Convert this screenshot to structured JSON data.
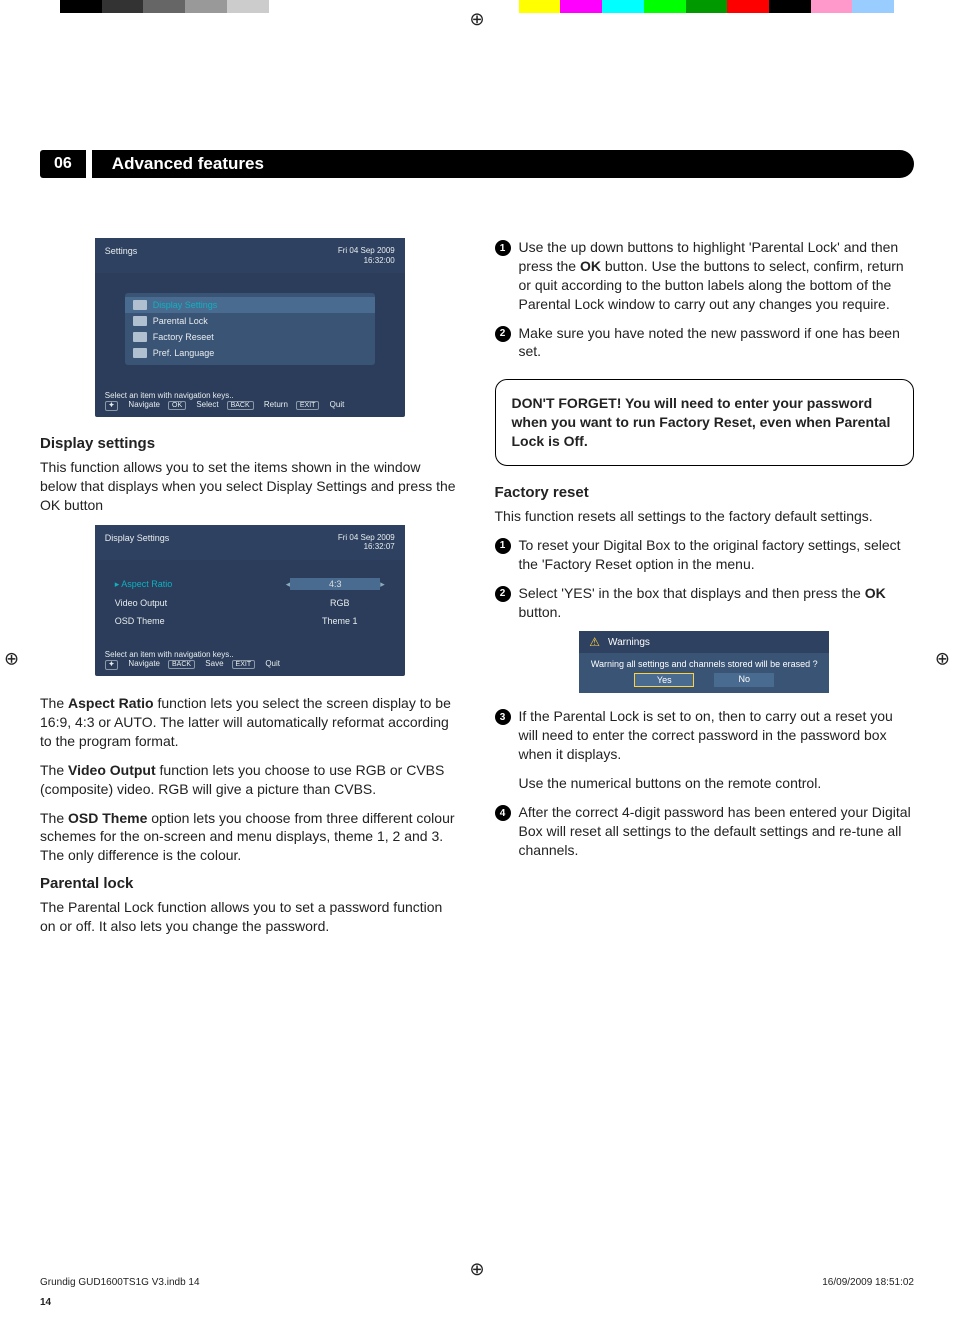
{
  "cal_colors": [
    "#000",
    "#333",
    "#666",
    "#999",
    "#ccc",
    "#fff",
    "#fff",
    "#fff",
    "#fff",
    "#fff",
    "#fff",
    "#ff0",
    "#f0f",
    "#0ff",
    "#0f0",
    "#090",
    "#f00",
    "#000",
    "#f9c",
    "#9cf"
  ],
  "header": {
    "num": "06",
    "title": "Advanced features"
  },
  "tv1": {
    "title": "Settings",
    "date": "Fri  04 Sep 2009",
    "time": "16:32:00",
    "items": [
      {
        "label": "Display Settings",
        "selected": true
      },
      {
        "label": "Parental Lock",
        "selected": false
      },
      {
        "label": "Factory Reseet",
        "selected": false
      },
      {
        "label": "Pref. Language",
        "selected": false
      }
    ],
    "footer_hint": "Select an item with navigation keys..",
    "footer_btns": [
      {
        "tag": "⯌",
        "label": "Navigate"
      },
      {
        "tag": "OK",
        "label": "Select"
      },
      {
        "tag": "BACK",
        "label": "Return"
      },
      {
        "tag": "EXIT",
        "label": "Quit"
      }
    ]
  },
  "left": {
    "h_display": "Display settings",
    "p_display": "This function allows you to set the items shown in the window below that displays when you select Display Settings and press the OK button",
    "p_aspect_pre": "The ",
    "p_aspect_b": "Aspect Ratio",
    "p_aspect_post": " function lets you select the screen display to be 16:9, 4:3 or AUTO. The latter will automatically reformat according to the program format.",
    "p_video_pre": "The ",
    "p_video_b": "Video Output",
    "p_video_post": " function lets you choose to use RGB or CVBS (composite) video. RGB will give a picture than CVBS.",
    "p_osd_pre": "The ",
    "p_osd_b": "OSD Theme",
    "p_osd_post": " option lets you choose from three different colour schemes for the on-screen and menu displays, theme 1, 2 and 3. The only difference is the colour.",
    "h_parental": "Parental lock",
    "p_parental": "The Parental Lock function allows you to set a password function on or off. It also lets you change the password."
  },
  "tv2": {
    "title": "Display Settings",
    "date": "Fri  04 Sep 2009",
    "time": "16:32:07",
    "rows": [
      {
        "label": "Aspect Ratio",
        "value": "4:3",
        "selected": true
      },
      {
        "label": "Video Output",
        "value": "RGB",
        "selected": false
      },
      {
        "label": "OSD Theme",
        "value": "Theme 1",
        "selected": false
      }
    ],
    "footer_hint": "Select an item with navigation keys..",
    "footer_btns": [
      {
        "tag": "⯌",
        "label": "Navigate"
      },
      {
        "tag": "BACK",
        "label": "Save"
      },
      {
        "tag": "EXIT",
        "label": "Quit"
      }
    ]
  },
  "right": {
    "steps_a": [
      "Use the up down buttons to highlight 'Parental Lock' and then press the OK button. Use the buttons to select, confirm, return or quit according to the button labels along the bottom of the Parental Lock window to carry out any changes you require.",
      "Make sure you have noted the new password if one has been set."
    ],
    "callout": "DON'T FORGET! You will need to enter your password when you want to run Factory Reset, even when Parental Lock is Off.",
    "h_factory": "Factory reset",
    "p_factory": "This function resets all settings to the factory default settings.",
    "steps_b": [
      "To reset your Digital Box to the original factory settings, select the 'Factory Reset option in the menu.",
      "Select 'YES' in the box that displays and then press the OK button."
    ],
    "steps_c": [
      "If the Parental Lock is set to on, then to carry out a reset you will need to enter the correct password in the password box when it displays.",
      "Use the numerical buttons on the remote control.",
      "After the correct 4-digit password has been entered your Digital Box will reset all settings to the default settings and re-tune all channels."
    ]
  },
  "warning": {
    "title": "Warnings",
    "body": "Warning all settings and channels stored will be erased ?",
    "yes": "Yes",
    "no": "No"
  },
  "footer": {
    "page": "14",
    "file": "Grundig GUD1600TS1G V3.indb   14",
    "stamp": "16/09/2009   18:51:02"
  }
}
